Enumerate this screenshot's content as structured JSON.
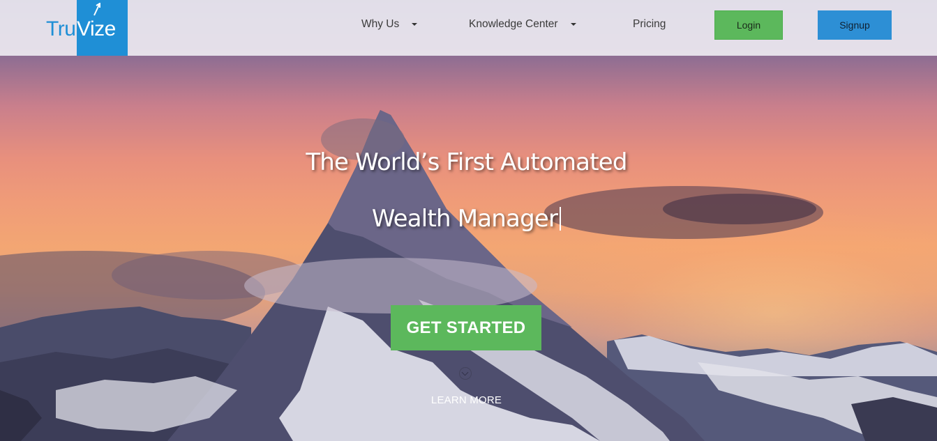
{
  "brand": {
    "name_part1": "Tru",
    "name_part2": "Vize",
    "logo_color": "#1f8fd6"
  },
  "nav": {
    "items": [
      {
        "label": "Why Us",
        "has_dropdown": true
      },
      {
        "label": "Knowledge Center",
        "has_dropdown": true
      },
      {
        "label": "Pricing",
        "has_dropdown": false
      }
    ],
    "login_label": "Login",
    "signup_label": "Signup"
  },
  "hero": {
    "headline_line1": "The World’s First Automated",
    "headline_line2": "Wealth Manager",
    "cta_label": "GET STARTED",
    "learn_more_label": "LEARN MORE"
  },
  "colors": {
    "green": "#5cb85c",
    "blue": "#2d8fd5"
  }
}
